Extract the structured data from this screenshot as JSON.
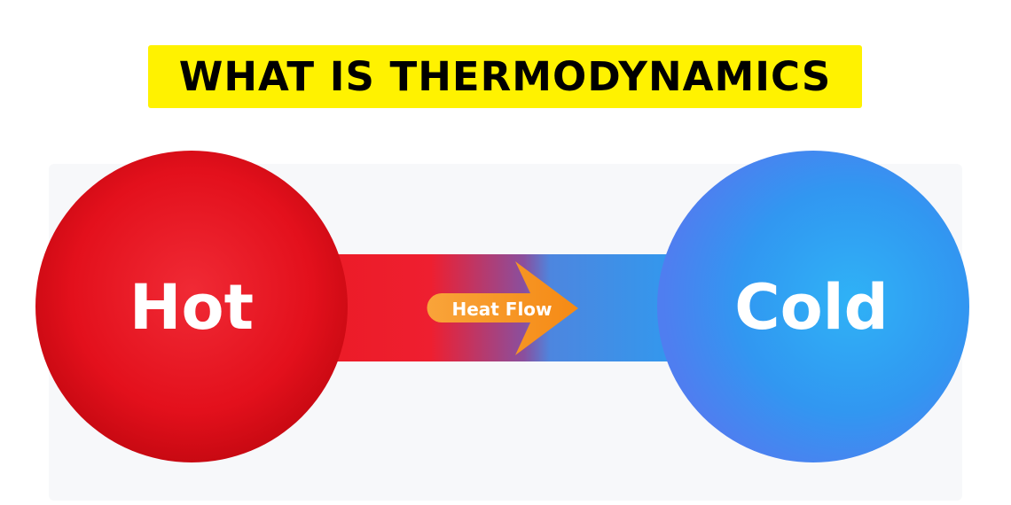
{
  "title": "WHAT IS THERMODYNAMICS",
  "hot": {
    "label": "Hot",
    "color": "#e3101c"
  },
  "cold": {
    "label": "Cold",
    "color": "#2f8df2"
  },
  "arrow": {
    "label": "Heat Flow",
    "color": "#f7931e"
  },
  "colors": {
    "banner": "#fff200",
    "title_text": "#000000"
  }
}
